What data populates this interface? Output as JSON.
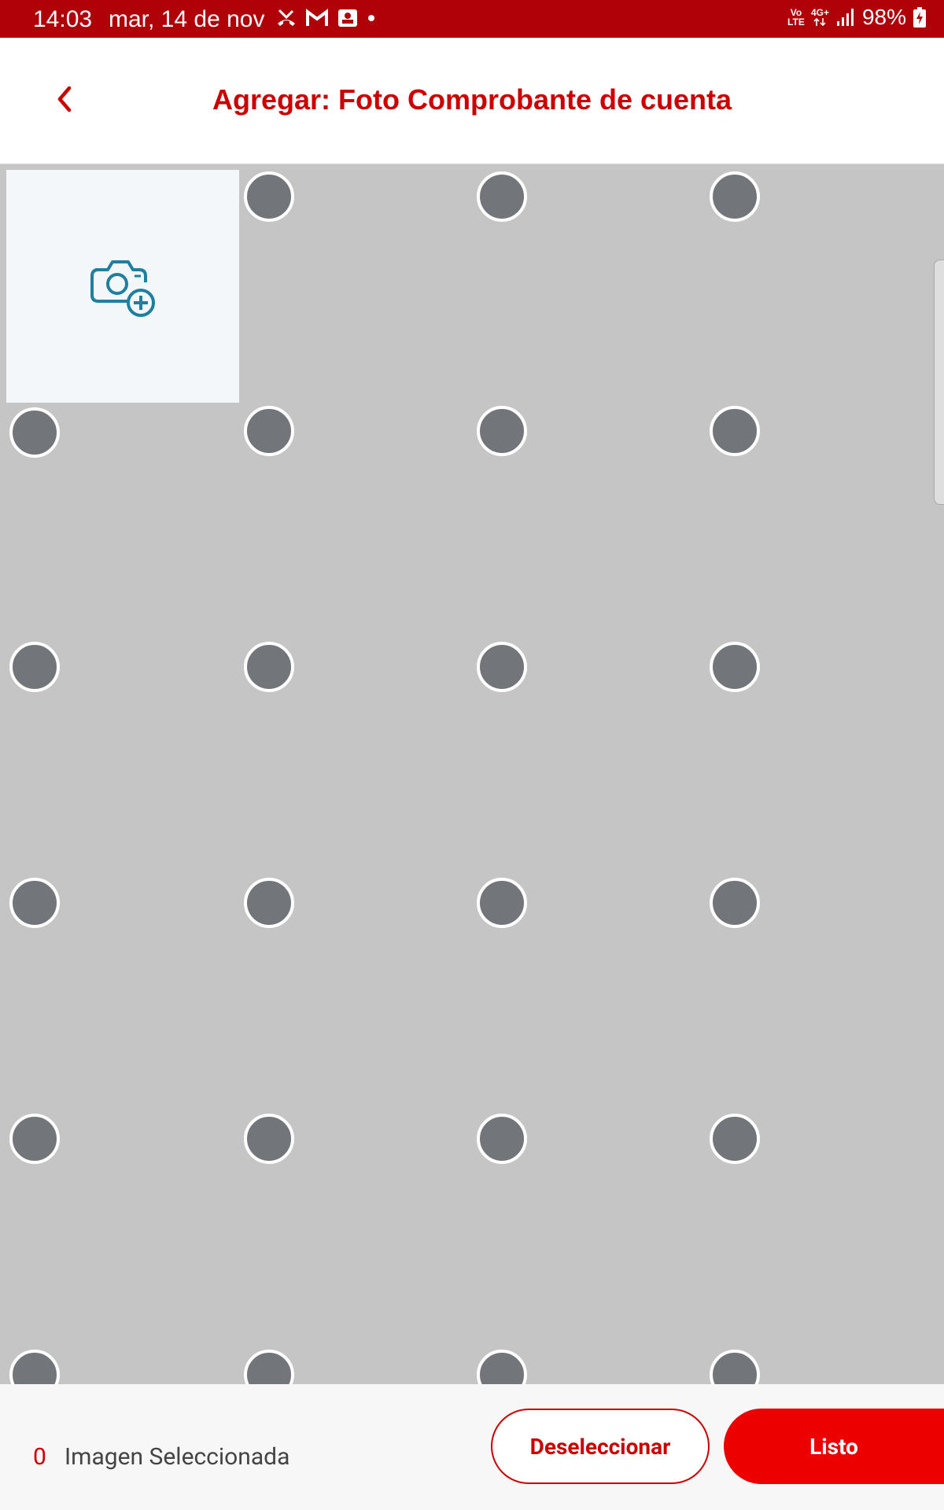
{
  "status_bar": {
    "time": "14:03",
    "date": "mar, 14 de nov",
    "lte_label": "Vo LTE",
    "network_label": "4G+",
    "battery": "98%",
    "notification_icons": [
      "missed-call-icon",
      "gmail-icon",
      "image-icon",
      "dot-icon"
    ]
  },
  "header": {
    "title": "Agregar: Foto Comprobante de cuenta",
    "back_icon": "chevron-left-icon"
  },
  "grid": {
    "add_photo_icon": "camera-plus-icon",
    "columns": 4,
    "selected": 0
  },
  "footer": {
    "count": "0",
    "count_label": "Imagen Seleccionada",
    "deselect_label": "Deseleccionar",
    "done_label": "Listo"
  },
  "colors": {
    "status_bar": "#b00008",
    "accent": "#cc0000",
    "primary_button": "#ec0000",
    "grid_background": "#c5c5c5",
    "radio_fill": "#72757a",
    "camera_icon": "#1e7fa0"
  }
}
